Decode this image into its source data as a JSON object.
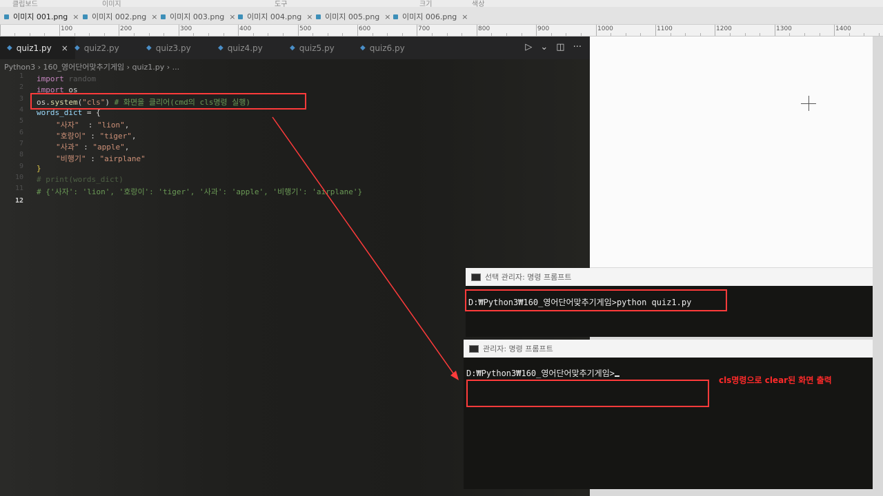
{
  "viewer": {
    "menu": [
      "클립보드",
      "이미지",
      "도구",
      "크기",
      "색상"
    ],
    "tabs": [
      "이미지 001.png",
      "이미지 002.png",
      "이미지 003.png",
      "이미지 004.png",
      "이미지 005.png",
      "이미지 006.png"
    ],
    "ruler": [
      "100",
      "200",
      "300",
      "400",
      "500",
      "600",
      "700",
      "800",
      "900",
      "1000",
      "1100",
      "1200",
      "1300",
      "1400"
    ]
  },
  "editor": {
    "tabs": [
      "quiz1.py",
      "quiz2.py",
      "quiz3.py",
      "quiz4.py",
      "quiz5.py",
      "quiz6.py"
    ],
    "close_icon": "×",
    "breadcrumb": "Python3 › 160_영어단어맞추기게임 › quiz1.py › ...",
    "line_numbers": [
      "1",
      "2",
      "3",
      "4",
      "5",
      "6",
      "7",
      "8",
      "9",
      "10",
      "11",
      "12"
    ],
    "lines": {
      "l1_kw": "import",
      "l1_mod": " random",
      "l2_kw": "import",
      "l2_mod": " os",
      "l3_a": "os.",
      "l3_fn": "system",
      "l3_b": "(",
      "l3_str": "\"cls\"",
      "l3_c": ") ",
      "l3_cm": "# 화면을 클리어(cmd의 cls명령 실행)",
      "l4_var": "words_dict",
      "l4_rest": " = {",
      "l5_k": "\"사자\"",
      "l5_sep": "  : ",
      "l5_v": "\"lion\"",
      "l5_end": ",",
      "l6_k": "\"호랑이\"",
      "l6_sep": " : ",
      "l6_v": "\"tiger\"",
      "l6_end": ",",
      "l7_k": "\"사과\"",
      "l7_sep": " : ",
      "l7_v": "\"apple\"",
      "l7_end": ",",
      "l8_k": "\"비행기\"",
      "l8_sep": " : ",
      "l8_v": "\"airplane\"",
      "l9": "}",
      "l10": "# print(words_dict)",
      "l11": "# {'사자': 'lion', '호랑이': 'tiger', '사과': 'apple', '비행기': 'airplane'}"
    }
  },
  "cmd1": {
    "title": "선택 관리자: 명령 프롬프트",
    "line": "D:₩Python3₩160_영어단어맞추기게임>python quiz1.py"
  },
  "cmd2": {
    "title": "관리자: 명령 프롬프트",
    "line": "D:₩Python3₩160_영어단어맞추기게임>"
  },
  "annotation": {
    "note": "cls명령으로 clear된 화면 출력",
    "color": "#ff3b3b"
  }
}
